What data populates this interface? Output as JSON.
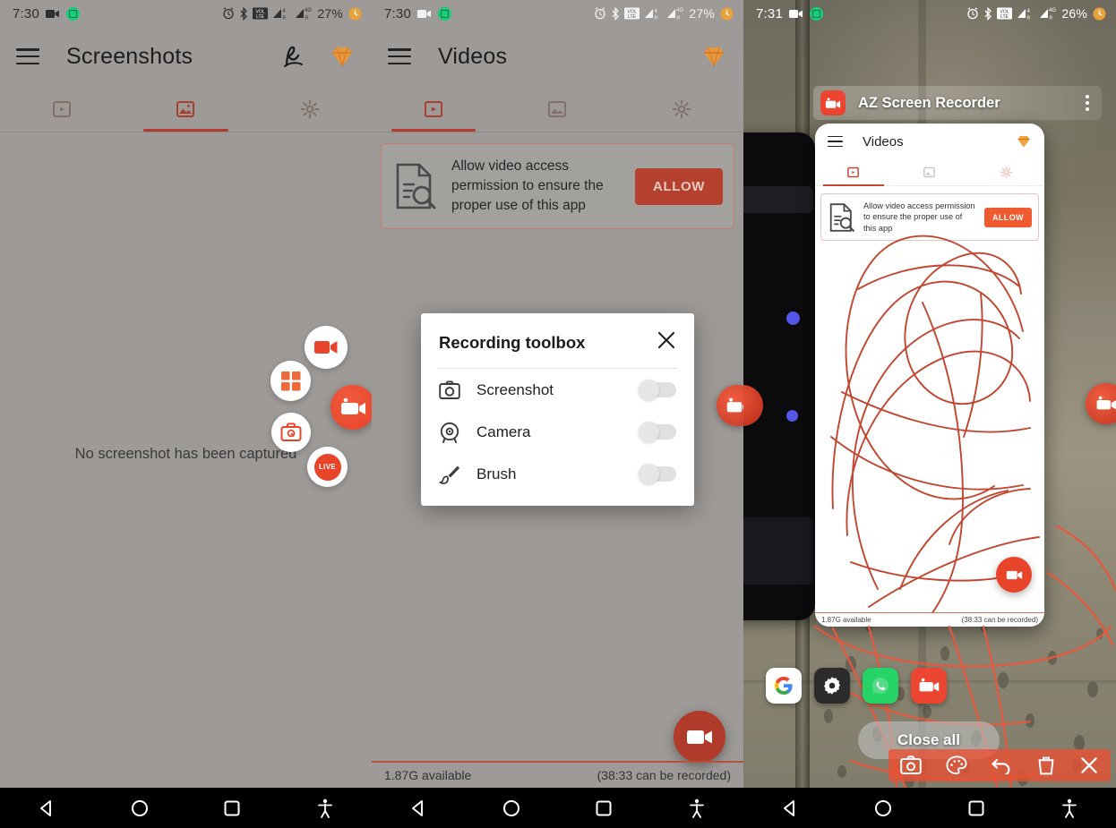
{
  "panels": [
    {
      "status": {
        "time": "7:30",
        "battery": "27%",
        "icons": [
          "camcorder-icon",
          "screen-record-icon",
          "alarm-icon",
          "bluetooth-icon",
          "volte-icon",
          "signal-1-icon",
          "signal-2-icon",
          "battery-icon"
        ]
      },
      "appbar": {
        "title": "Screenshots",
        "menu": "menu-icon",
        "actions": [
          "signature-icon",
          "gem-icon"
        ]
      },
      "tabs": [
        {
          "name": "videos",
          "icon": "video-tab-icon",
          "active": false
        },
        {
          "name": "screenshots",
          "icon": "image-tab-icon",
          "active": true
        },
        {
          "name": "settings",
          "icon": "settings-tab-icon",
          "active": false
        }
      ],
      "empty_message": "No screenshot has been captured",
      "bubbles": [
        "record-bubble",
        "apps-grid-bubble",
        "toolbox-bubble",
        "live-bubble",
        "record-main-bubble"
      ]
    },
    {
      "status": {
        "time": "7:30",
        "battery": "27%"
      },
      "appbar": {
        "title": "Videos",
        "menu": "menu-icon",
        "actions": [
          "gem-icon"
        ]
      },
      "tabs": [
        {
          "name": "videos",
          "icon": "video-tab-icon",
          "active": true
        },
        {
          "name": "screenshots",
          "icon": "image-tab-icon",
          "active": false
        },
        {
          "name": "settings",
          "icon": "settings-tab-icon",
          "active": false
        }
      ],
      "permission": {
        "message": "Allow video access permission to ensure the proper use of this app",
        "button": "ALLOW",
        "icon": "document-search-icon"
      },
      "dialog": {
        "title": "Recording toolbox",
        "close": "close-icon",
        "rows": [
          {
            "label": "Screenshot",
            "icon": "camera-icon",
            "on": false
          },
          {
            "label": "Camera",
            "icon": "front-camera-icon",
            "on": false
          },
          {
            "label": "Brush",
            "icon": "brush-icon",
            "on": false
          }
        ]
      },
      "storage": {
        "available": "1.87G available",
        "duration": "(38:33 can be recorded)"
      },
      "fab": "record-fab"
    },
    {
      "status": {
        "time": "7:31",
        "battery": "26%"
      },
      "recents": {
        "app_name": "AZ Screen Recorder",
        "app_icon": "az-recorder-icon",
        "kebab": "more-options-icon"
      },
      "mini": {
        "title": "Videos",
        "menu": "menu-icon",
        "gem": "gem-icon",
        "tabs": [
          {
            "name": "videos",
            "active": true
          },
          {
            "name": "screenshots",
            "active": false
          },
          {
            "name": "settings",
            "active": false
          }
        ],
        "permission": {
          "message": "Allow video access permission to ensure the proper use of this app",
          "button": "ALLOW",
          "icon": "document-search-icon"
        },
        "storage": {
          "available": "1.87G available",
          "duration": "(38:33 can be recorded)"
        },
        "fab": "record-fab"
      },
      "close_all": "Close all",
      "draw_toolbar": [
        "screenshot-icon",
        "palette-icon",
        "undo-icon",
        "trash-icon",
        "close-icon"
      ],
      "dock": [
        "google-icon",
        "settings-icon",
        "whatsapp-icon",
        "az-recorder-icon"
      ]
    }
  ],
  "navbar": {
    "back": "back-icon",
    "home": "home-icon",
    "recents": "recents-icon",
    "accessibility": "accessibility-icon"
  },
  "colors": {
    "accent": "#e8442a",
    "accent_dark": "#b03b2b",
    "allow_button": "#b6402e",
    "allow_button_bright": "#ef5a2e",
    "panel_bg": "#9d9a97",
    "scribble": "#c2452f",
    "tab_indicator": "#b03b2e"
  }
}
